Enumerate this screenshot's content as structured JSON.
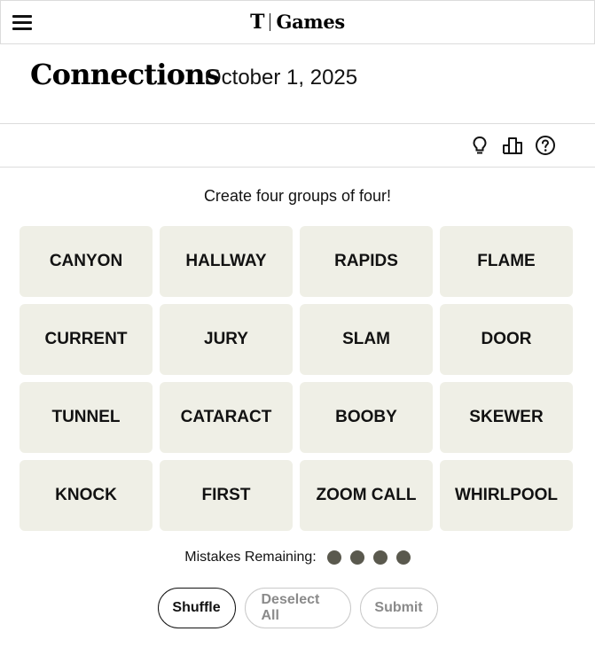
{
  "header": {
    "brand_logo": "T",
    "brand_name": "Games"
  },
  "title": {
    "game_name": "Connections",
    "date": "October 1, 2025"
  },
  "toolbar": {
    "icons": [
      "lightbulb-icon",
      "leaderboard-icon",
      "help-icon"
    ]
  },
  "instructions": "Create four groups of four!",
  "tiles": [
    "CANYON",
    "HALLWAY",
    "RAPIDS",
    "FLAME",
    "CURRENT",
    "JURY",
    "SLAM",
    "DOOR",
    "TUNNEL",
    "CATARACT",
    "BOOBY",
    "SKEWER",
    "KNOCK",
    "FIRST",
    "ZOOM CALL",
    "WHIRLPOOL"
  ],
  "mistakes": {
    "label": "Mistakes Remaining:",
    "remaining": 4
  },
  "buttons": {
    "shuffle": "Shuffle",
    "deselect_all": "Deselect All",
    "submit": "Submit"
  },
  "colors": {
    "tile_bg": "#efefe6",
    "dot": "#5a594e",
    "text": "#121212",
    "disabled_text": "#8a8a8a"
  }
}
